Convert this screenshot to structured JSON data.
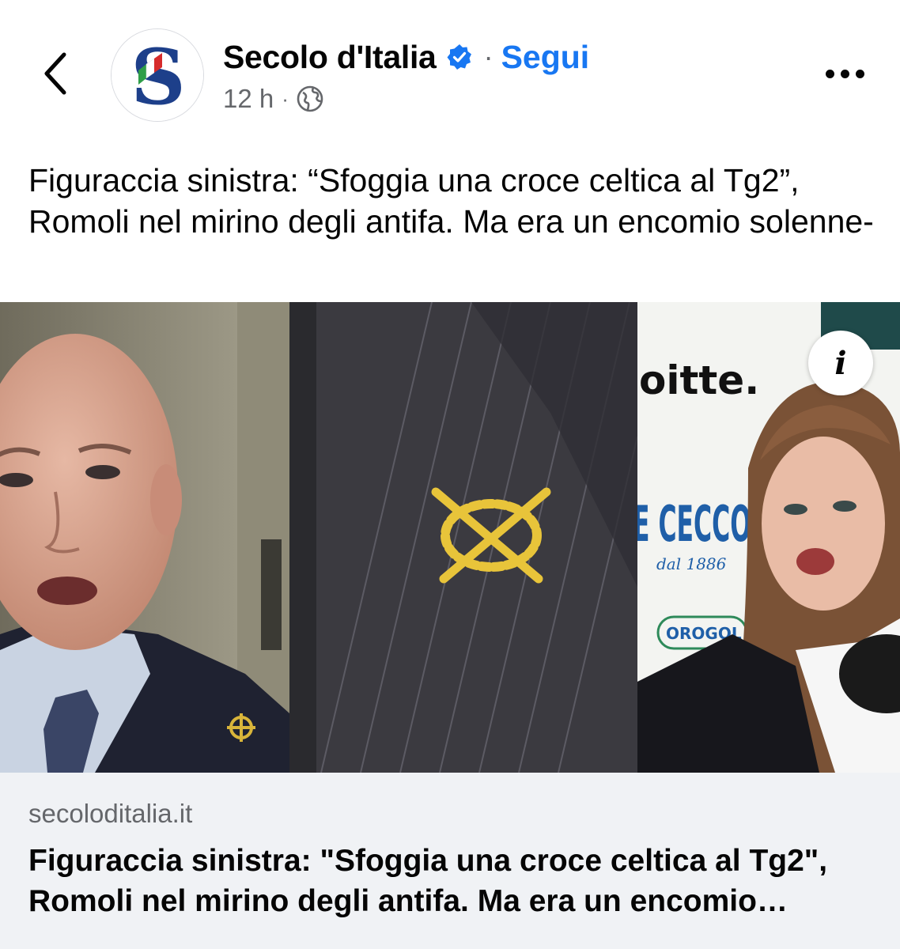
{
  "header": {
    "back_icon": "chevron-left-icon",
    "page_name": "Secolo d'Italia",
    "verified_icon": "verified-badge-icon",
    "separator": "·",
    "follow_label": "Segui",
    "time": "12 h",
    "meta_separator": "·",
    "audience_icon": "globe-icon",
    "more_icon": "more-horizontal-icon",
    "avatar_letter": "S"
  },
  "post": {
    "caption": "Figuraccia sinistra: “Sfoggia una croce celtica al Tg2”, Romoli nel mirino degli antifa. Ma era un encomio solenne-"
  },
  "image": {
    "sign_text_1": "oitte.",
    "sign_text_2": "E CECCO",
    "sign_text_3": "dal 1886",
    "sign_text_4": "OROGOL",
    "info_icon": "info-icon",
    "info_glyph": "i"
  },
  "link_preview": {
    "domain": "secoloditalia.it",
    "title": "Figuraccia sinistra: \"Sfoggia una croce celtica al Tg2\", Romoli nel mirino degli antifa. Ma era un encomio solenne"
  },
  "colors": {
    "accent": "#1877f2",
    "secondary_text": "#65676b",
    "footer_bg": "#f0f2f5",
    "logo_blue": "#1d3f8a"
  }
}
